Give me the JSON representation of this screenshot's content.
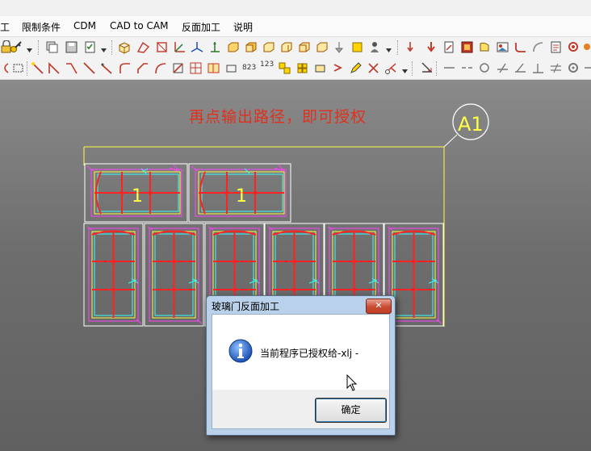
{
  "menu": {
    "items": [
      {
        "label": "工"
      },
      {
        "label": "限制条件"
      },
      {
        "label": "CDM"
      },
      {
        "label": "CAD to CAM"
      },
      {
        "label": "反面加工"
      },
      {
        "label": "说明"
      }
    ]
  },
  "toolbar1": {
    "icons": [
      "lock-key",
      "key",
      "settings",
      "cube",
      "axis-xy",
      "axis-xyz",
      "axis-z",
      "box-a",
      "box-b",
      "box-c",
      "box-d",
      "box-e",
      "pin",
      "square",
      "person",
      "pen",
      "arrow-down",
      "doc-flip",
      "image",
      "shape",
      "curve-a",
      "curve-b",
      "note",
      "gear-red"
    ]
  },
  "toolbar2": {
    "icons": [
      "curve-left",
      "line-a",
      "line-b",
      "line-c",
      "line-d",
      "arc",
      "corner",
      "triangle",
      "square-x",
      "tr-grid",
      "tr-split",
      "rect",
      "number-seq-1",
      "number-seq-2",
      "group",
      "group-small",
      "rect-small",
      "chevron",
      "edit",
      "cross",
      "scissors",
      "pointer",
      "line-dash",
      "circle",
      "line-slash",
      "angle",
      "perp",
      "diag",
      "gear"
    ]
  },
  "number_labels": {
    "a": "823",
    "b": "123"
  },
  "canvas": {
    "instruction": "再点输出路径，即可授权",
    "tag": "A1",
    "panel_number_1": "1",
    "panel_number_2": "1"
  },
  "dialog": {
    "title": "玻璃门反面加工",
    "message": "当前程序已授权给-xlj -",
    "ok_label": "确定",
    "close_label": "✕"
  },
  "colors": {
    "accent_red": "#e0301e",
    "cad_yellow": "#ffff44",
    "cad_magenta": "#ff44ff",
    "cad_cyan": "#33ffff"
  }
}
